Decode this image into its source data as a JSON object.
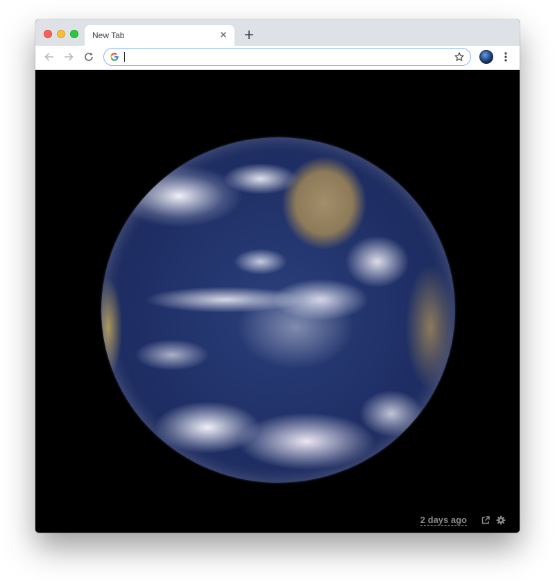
{
  "browser": {
    "tab": {
      "title": "New Tab",
      "close_icon": "close-icon"
    },
    "new_tab_icon": "plus-icon",
    "toolbar": {
      "back_icon": "arrow-left-icon",
      "forward_icon": "arrow-right-icon",
      "reload_icon": "reload-icon",
      "omnibox": {
        "value": "",
        "search_engine_icon": "google-g-icon",
        "bookmark_icon": "star-icon"
      },
      "extension_icon": "earth-extension-icon",
      "menu_icon": "kebab-menu-icon"
    }
  },
  "page": {
    "image": "earth-from-space",
    "footer": {
      "time_ago": "2 days ago",
      "open_icon": "external-link-icon",
      "settings_icon": "gear-icon"
    }
  },
  "colors": {
    "tabstrip": "#dee1e6",
    "omnibox_focus": "#8ab4f8",
    "content_background": "#000000",
    "footer_text": "#8a8a8a"
  }
}
